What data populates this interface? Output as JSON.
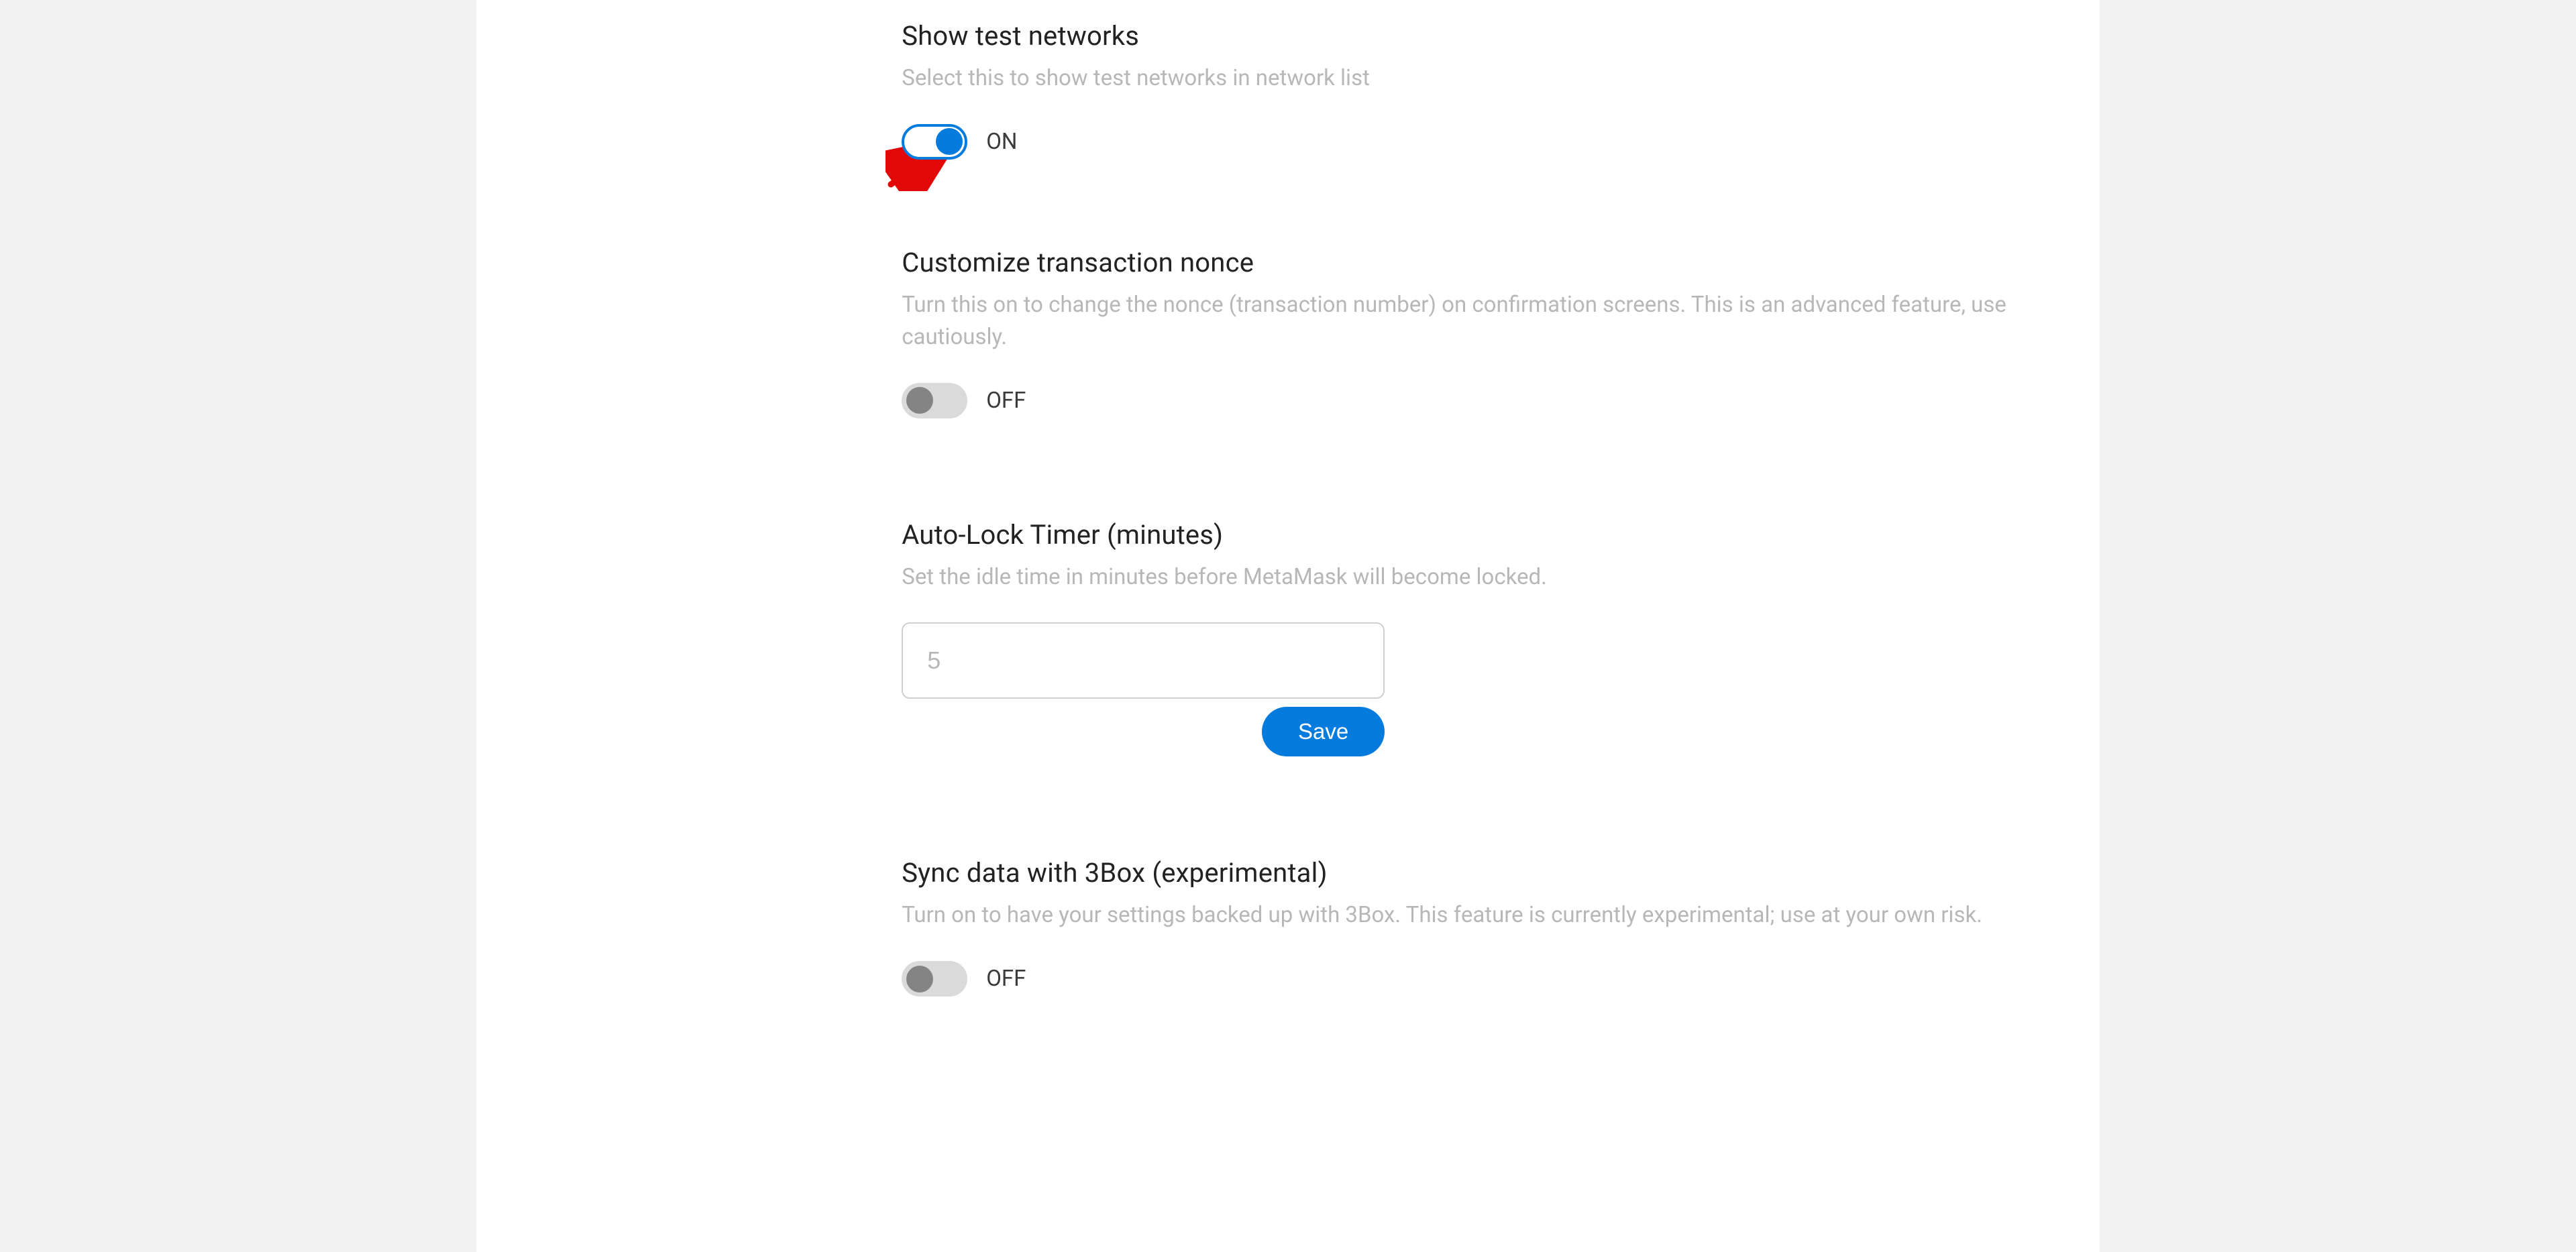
{
  "settings": {
    "showTestNetworks": {
      "title": "Show test networks",
      "desc": "Select this to show test networks in network list",
      "state": "ON"
    },
    "customizeNonce": {
      "title": "Customize transaction nonce",
      "desc": "Turn this on to change the nonce (transaction number) on confirmation screens. This is an advanced feature, use cautiously.",
      "state": "OFF"
    },
    "autoLockTimer": {
      "title": "Auto-Lock Timer (minutes)",
      "desc": "Set the idle time in minutes before MetaMask will become locked.",
      "placeholder": "5",
      "saveLabel": "Save"
    },
    "sync3box": {
      "title": "Sync data with 3Box (experimental)",
      "desc": "Turn on to have your settings backed up with 3Box. This feature is currently experimental; use at your own risk.",
      "state": "OFF"
    }
  },
  "colors": {
    "accent": "#047bdd"
  }
}
